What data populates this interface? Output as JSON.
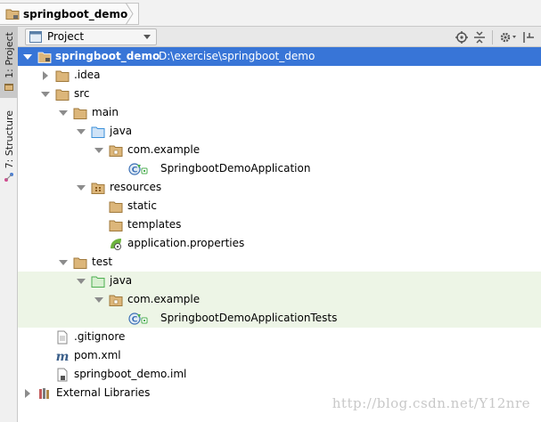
{
  "breadcrumb": {
    "project_name": "springboot_demo"
  },
  "side_tabs": {
    "project": "1: Project",
    "structure": "7: Structure"
  },
  "tool_window": {
    "view_mode": "Project"
  },
  "tree": {
    "root": {
      "name": "springboot_demo",
      "path": "D:\\exercise\\springboot_demo"
    },
    "idea": ".idea",
    "src": "src",
    "main": "main",
    "main_java": "java",
    "main_package": "com.example",
    "main_class": "SpringbootDemoApplication",
    "resources": "resources",
    "static_dir": "static",
    "templates_dir": "templates",
    "properties": "application.properties",
    "test": "test",
    "test_java": "java",
    "test_package": "com.example",
    "test_class": "SpringbootDemoApplicationTests",
    "gitignore": ".gitignore",
    "pom": "pom.xml",
    "iml": "springboot_demo.iml",
    "libraries": "External Libraries"
  },
  "watermark": "http://blog.csdn.net/Y12nre",
  "colors": {
    "selection": "#3875d7",
    "test_background": "#edf5e6",
    "folder": "#dcb67a",
    "source_folder": "#3a8fd9",
    "test_folder": "#4caf50"
  }
}
